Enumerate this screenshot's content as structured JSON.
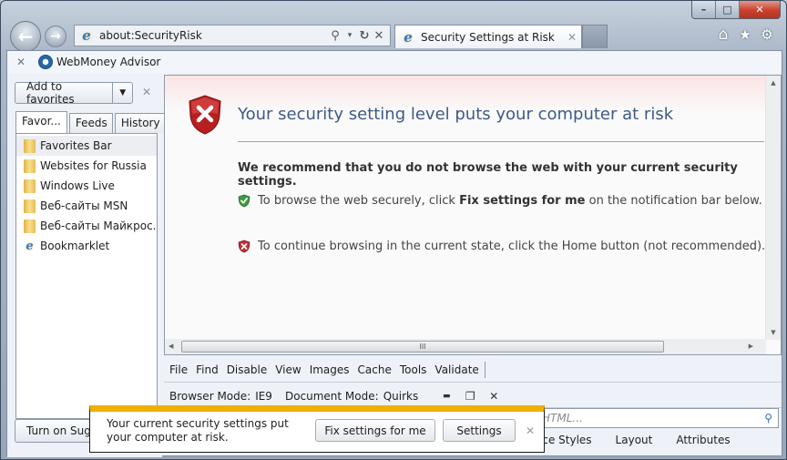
{
  "window": {
    "caption": {
      "minimize": "–",
      "maximize": "□",
      "close": "✕"
    }
  },
  "nav": {
    "back_glyph": "←",
    "forward_glyph": "→",
    "address": "about:SecurityRisk",
    "search_glyph": "⚲",
    "dropdown_glyph": "▾",
    "refresh_glyph": "↻",
    "stop_glyph": "✕"
  },
  "tabs": [
    {
      "title": "Security Settings at Risk",
      "close": "✕",
      "active": true
    }
  ],
  "toolbar_icons": {
    "home": "⌂",
    "favorites": "★",
    "tools": "⚙"
  },
  "webmoney": {
    "close": "✕",
    "label": "WebMoney Advisor"
  },
  "favorites_panel": {
    "add_button": "Add to favorites",
    "dropdown": "▼",
    "close": "✕",
    "tabs": [
      "Favor...",
      "Feeds",
      "History"
    ],
    "items": [
      {
        "label": "Favorites Bar",
        "type": "folder",
        "selected": true
      },
      {
        "label": "Websites for Russia",
        "type": "folder"
      },
      {
        "label": "Windows Live",
        "type": "folder"
      },
      {
        "label": "Веб-сайты MSN",
        "type": "folder"
      },
      {
        "label": "Веб-сайты Майкрос...",
        "type": "folder"
      },
      {
        "label": "Bookmarklet",
        "type": "link"
      }
    ],
    "suggest_button": "Turn on Suggested Sites"
  },
  "page": {
    "title": "Your security setting level puts your computer at risk",
    "recommendation": "We recommend that you do not browse the web with your current security settings.",
    "line1_pre": "To browse the web securely, click ",
    "line1_bold": "Fix settings for me",
    "line1_post": " on the notification bar below.",
    "line2": "To continue browsing in the current state, click the Home button (not recommended).",
    "hscroll_grip": "III"
  },
  "devtools": {
    "menu": [
      "File",
      "Find",
      "Disable",
      "View",
      "Images",
      "Cache",
      "Tools",
      "Validate"
    ],
    "browser_mode_label": "Browser Mode:",
    "browser_mode_value": "IE9",
    "document_mode_label": "Document Mode:",
    "document_mode_value": "Quirks",
    "ctrl_minimize": "▬",
    "ctrl_popout": "❐",
    "ctrl_close": "✕",
    "search_placeholder": "HTML...",
    "search_glyph": "⚲",
    "tabs": [
      "ace Styles",
      "Layout",
      "Attributes"
    ]
  },
  "notification": {
    "message": "Your current security settings put your computer at risk.",
    "fix_button": "Fix settings for me",
    "settings_button": "Settings",
    "close": "✕",
    "accent_color": "#efb000"
  }
}
